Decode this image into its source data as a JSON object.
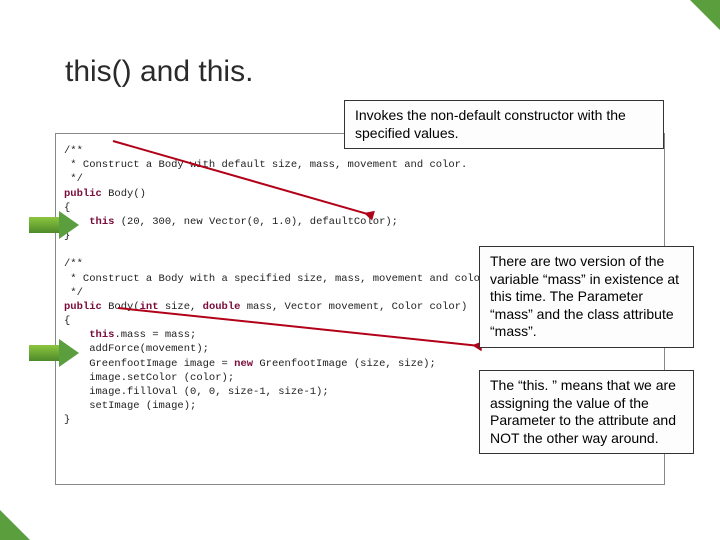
{
  "title": "this() and this.",
  "callouts": {
    "top": "Invokes the non-default constructor with the specified values.",
    "mid": "There are two version of the variable “mass” in existence at this time. The Parameter “mass” and the class attribute “mass”.",
    "bottom": "The “this. ” means that we are assigning the value of the Parameter to the attribute and NOT the other way around."
  },
  "code": {
    "c1a": "/**",
    "c1b": " * Construct a Body with default size, mass, movement and color.",
    "c1c": " */",
    "sig1_kw": "public",
    "sig1_rest": " Body()",
    "brace_open": "{",
    "call_this_kw": "this",
    "call_this_rest": " (20, 300, new Vector(0, 1.0), defaultColor);",
    "brace_close": "}",
    "c2a": "/**",
    "c2b": " * Construct a Body with a specified size, mass, movement and color.",
    "c2c": " */",
    "sig2_kw1": "public",
    "sig2_mid1": " Body(",
    "sig2_kw2": "int",
    "sig2_mid2": " size, ",
    "sig2_kw3": "double",
    "sig2_mid3": " mass, Vector movement, Color color)",
    "assign_kw": "this",
    "assign_rest": ".mass = mass;",
    "l_addforce": "    addForce(movement);",
    "l_img_a": "    GreenfootImage image = ",
    "l_img_kw": "new",
    "l_img_b": " GreenfootImage (size, size);",
    "l_setcolor": "    image.setColor (color);",
    "l_filloval": "    image.fillOval (0, 0, size-1, size-1);",
    "l_setimage": "    setImage (image);"
  }
}
